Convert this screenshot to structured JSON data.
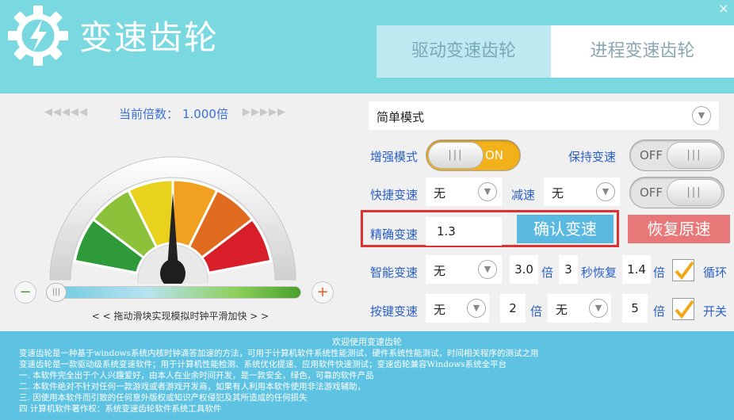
{
  "app": {
    "title": "变速齿轮",
    "close_label": "×"
  },
  "tabs": [
    {
      "label": "驱动变速齿轮",
      "active": true
    },
    {
      "label": "进程变速齿轮",
      "active": false
    }
  ],
  "left": {
    "arrows_left": "◀◀◀◀◀",
    "arrows_right": "▶▶▶▶▶",
    "rate_label": "当前倍数：",
    "rate_value": "1.000倍",
    "slider_minus": "−",
    "slider_plus": "+",
    "slider_thumb_grip": "|||",
    "slider_position": 0.0,
    "slider_hint": "< < 拖动滑块实现模拟时钟平滑加快 > >",
    "gauge_needle_level": 0.5,
    "gauge_colors": [
      "#2e9a3a",
      "#8cc23a",
      "#e8d21e",
      "#f2a020",
      "#e06a1e",
      "#d81e28"
    ]
  },
  "right": {
    "mode_select": {
      "value": "简单模式",
      "arrow_icon": "chevron-down-icon"
    },
    "enhance": {
      "label": "增强模式",
      "knob_grip": "|||",
      "state_text": "ON",
      "on": true
    },
    "keep": {
      "label": "保持变速",
      "knob_grip": "|||",
      "state_text": "OFF",
      "on": false
    },
    "hotkey": {
      "label": "快捷变速",
      "value": "无",
      "slow_label": "减速",
      "slow_value": "无"
    },
    "hotkey_toggle": {
      "knob_grip": "|||",
      "state_text": "OFF",
      "on": false
    },
    "precise": {
      "label": "精确变速",
      "value": "1.3",
      "confirm_label": "确认变速",
      "restore_label": "恢复原速"
    },
    "smart": {
      "label": "智能变速",
      "value": "无",
      "multiplier": "3.0",
      "times_unit": "倍",
      "seconds": "3",
      "restore_text": "秒恢复",
      "restore_value": "1.4",
      "times_unit2": "倍",
      "loop_label": "循环",
      "loop_checked": true
    },
    "keypress": {
      "label": "按键变速",
      "value": "无",
      "multiplier": "2",
      "times_unit": "倍",
      "value2": "无",
      "multiplier2": "5",
      "times_unit2": "倍",
      "enable_label": "开关",
      "enable_checked": true
    }
  },
  "info": {
    "title": "欢迎使用变速齿轮",
    "lines": [
      "变速齿轮是一种基于windows系统内核时钟滴答加速的方法，可用于计算机软件系统性能测试，硬件系统性能测试，时间相关程序的测试之用",
      "变速齿轮是一款驱动级系统变速软件；用于计算机性能检测、系统优化提速、应用软件快速测试；变速齿轮兼容Windows系统全平台",
      "一. 本软件完全出于个人兴趣爱好，由本人在业余时间开发，是一款安全，绿色，可靠的软件产品",
      "二. 本软件绝对不针对任何一款游戏或者游戏开发商，如果有人利用本软件使用非法游戏辅助，",
      "三. 因使用本软件而引致的任何意外版权或知识产权侵犯及其所造成的任何损失",
      "四  计算机软件著作权：系统变速齿轮软件系统工具软件"
    ]
  },
  "colors": {
    "header_bg": "#79d8e0",
    "info_bg": "#5ec3e3",
    "label_blue": "#2a5fc8",
    "confirm_bg": "#5ab9e0",
    "restore_bg": "#e87878",
    "toggle_on": "#f2b01a",
    "highlight_frame": "#e03030"
  }
}
